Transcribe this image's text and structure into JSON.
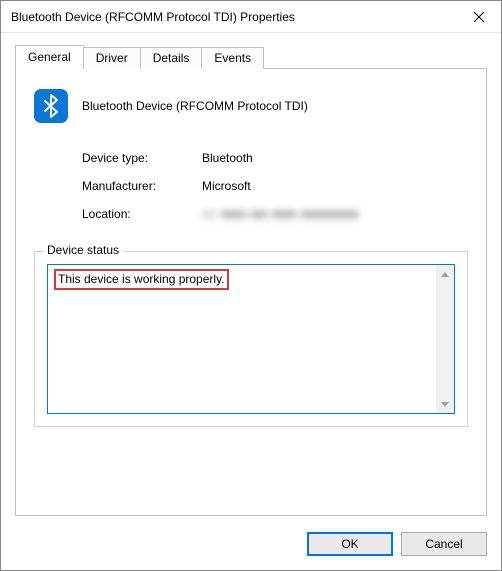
{
  "window": {
    "title": "Bluetooth Device (RFCOMM Protocol TDI) Properties"
  },
  "tabs": {
    "general": "General",
    "driver": "Driver",
    "details": "Details",
    "events": "Events"
  },
  "device": {
    "name": "Bluetooth Device (RFCOMM Protocol TDI)"
  },
  "props": {
    "device_type_label": "Device type:",
    "device_type_value": "Bluetooth",
    "manufacturer_label": "Manufacturer:",
    "manufacturer_value": "Microsoft",
    "location_label": "Location:",
    "location_value": "on ■■■-■■ ■■■ ■■■■■■■"
  },
  "status": {
    "legend": "Device status",
    "text": "This device is working properly."
  },
  "buttons": {
    "ok": "OK",
    "cancel": "Cancel"
  }
}
